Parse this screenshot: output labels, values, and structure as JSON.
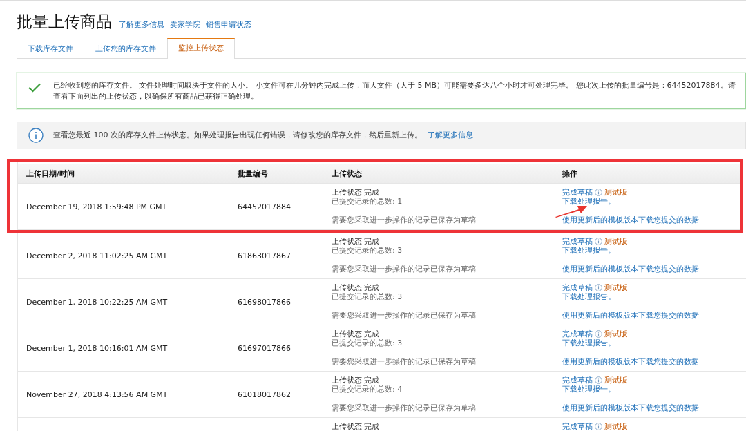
{
  "header": {
    "title": "批量上传商品",
    "links": [
      "了解更多信息",
      "卖家学院",
      "销售申请状态"
    ]
  },
  "tabs": [
    {
      "label": "下载库存文件",
      "selected": false
    },
    {
      "label": "上传您的库存文件",
      "selected": false
    },
    {
      "label": "监控上传状态",
      "selected": true
    }
  ],
  "success_message": {
    "text": "已经收到您的库存文件。 文件处理时间取决于文件的大小。 小文件可在几分钟内完成上传，而大文件（大于 5 MB）可能需要多达八个小时才可处理完毕。 您此次上传的批量编号是：64452017884。请查看下面列出的上传状态，以确保所有商品已获得正确处理。"
  },
  "info_message": {
    "text": "查看您最近 100 次的库存文件上传状态。如果处理报告出现任何错误，请修改您的库存文件，然后重新上传。",
    "link": "了解更多信息"
  },
  "table": {
    "columns": [
      "上传日期/时间",
      "批量编号",
      "上传状态",
      "操作"
    ],
    "rows": [
      {
        "date": "December 19, 2018 1:59:48 PM GMT",
        "batch": "64452017884",
        "status": "上传状态 完成",
        "count": "已提交记录的总数: 1",
        "note": "需要您采取进一步操作的记录已保存为草稿",
        "draft": "完成草稿",
        "beta": "测试版",
        "report": "下载处理报告。",
        "download": "使用更新后的模板版本下载您提交的数据",
        "highlighted": true
      },
      {
        "date": "December 2, 2018 11:02:25 AM GMT",
        "batch": "61863017867",
        "status": "上传状态 完成",
        "count": "已提交记录的总数: 3",
        "note": "需要您采取进一步操作的记录已保存为草稿",
        "draft": "完成草稿",
        "beta": "测试版",
        "report": "下载处理报告。",
        "download": "使用更新后的模板版本下载您提交的数据",
        "highlighted": false
      },
      {
        "date": "December 1, 2018 10:22:25 AM GMT",
        "batch": "61698017866",
        "status": "上传状态 完成",
        "count": "已提交记录的总数: 3",
        "note": "需要您采取进一步操作的记录已保存为草稿",
        "draft": "完成草稿",
        "beta": "测试版",
        "report": "下载处理报告。",
        "download": "使用更新后的模板版本下载您提交的数据",
        "highlighted": false
      },
      {
        "date": "December 1, 2018 10:16:01 AM GMT",
        "batch": "61697017866",
        "status": "上传状态 完成",
        "count": "已提交记录的总数: 3",
        "note": "需要您采取进一步操作的记录已保存为草稿",
        "draft": "完成草稿",
        "beta": "测试版",
        "report": "下载处理报告。",
        "download": "使用更新后的模板版本下载您提交的数据",
        "highlighted": false
      },
      {
        "date": "November 27, 2018 4:13:56 AM GMT",
        "batch": "61018017862",
        "status": "上传状态 完成",
        "count": "已提交记录的总数: 4",
        "note": "需要您采取进一步操作的记录已保存为草稿",
        "draft": "完成草稿",
        "beta": "测试版",
        "report": "下载处理报告。",
        "download": "使用更新后的模板版本下载您提交的数据",
        "highlighted": false
      },
      {
        "status": "上传状态 完成",
        "draft": "完成草稿",
        "beta": "测试版",
        "highlighted": false
      }
    ]
  }
}
